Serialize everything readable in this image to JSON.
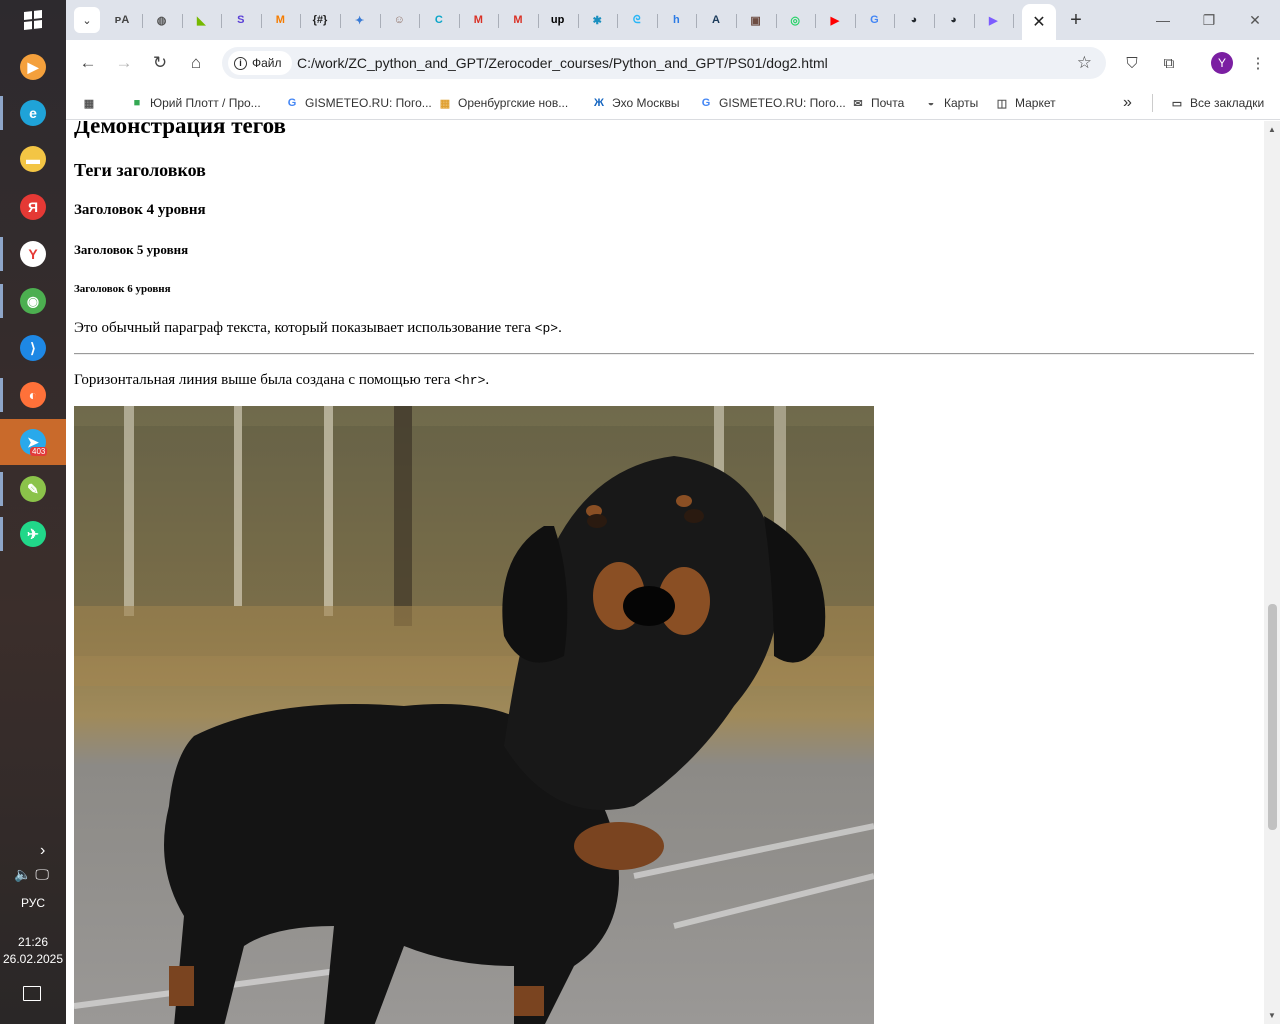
{
  "taskbar": {
    "apps": [
      {
        "name": "media-player-icon",
        "color": "#f4a03c",
        "glyph": "▶"
      },
      {
        "name": "edge-icon",
        "color": "#1fa3d8",
        "glyph": "e"
      },
      {
        "name": "file-explorer-icon",
        "color": "#f3c544",
        "glyph": "▬"
      },
      {
        "name": "yandex-icon",
        "color": "#e53935",
        "glyph": "Я"
      },
      {
        "name": "yandex-browser-icon",
        "color": "#ffffff",
        "glyph": "Y"
      },
      {
        "name": "chrome-icon",
        "color": "#4caf50",
        "glyph": "◉"
      },
      {
        "name": "vscode-icon",
        "color": "#1e88e5",
        "glyph": "⟩"
      },
      {
        "name": "firefox-icon",
        "color": "#ff7139",
        "glyph": "◐"
      },
      {
        "name": "telegram-icon",
        "color": "#29a9eb",
        "glyph": "➤"
      },
      {
        "name": "notepad-plus-icon",
        "color": "#8bc34a",
        "glyph": "✎"
      },
      {
        "name": "pycharm-icon",
        "color": "#21d789",
        "glyph": "✈"
      }
    ],
    "telegram_badge": "403",
    "language": "РУС",
    "time": "21:26",
    "date": "26.02.2025"
  },
  "browser": {
    "pinned_tabs": [
      {
        "name": "tab-translate",
        "glyph": "ᴘA",
        "color": "#444444"
      },
      {
        "name": "tab-globe",
        "glyph": "◍",
        "color": "#555555"
      },
      {
        "name": "tab-nvidia",
        "glyph": "◣",
        "color": "#76b900"
      },
      {
        "name": "tab-s",
        "glyph": "S",
        "color": "#5a3fd6"
      },
      {
        "name": "tab-m-orange",
        "glyph": "M",
        "color": "#f57c00"
      },
      {
        "name": "tab-hashtag",
        "glyph": "{#}",
        "color": "#222222"
      },
      {
        "name": "tab-bird",
        "glyph": "✦",
        "color": "#3a7bd5"
      },
      {
        "name": "tab-person",
        "glyph": "☺",
        "color": "#8d6e63"
      },
      {
        "name": "tab-copilot",
        "glyph": "C",
        "color": "#0aa5c8"
      },
      {
        "name": "tab-gmail",
        "glyph": "M",
        "color": "#d93025"
      },
      {
        "name": "tab-gmail-2",
        "glyph": "M",
        "color": "#d93025"
      },
      {
        "name": "tab-up",
        "glyph": "up",
        "color": "#000000"
      },
      {
        "name": "tab-openai",
        "glyph": "✱",
        "color": "#1a8fbf"
      },
      {
        "name": "tab-wave",
        "glyph": "ᘓ",
        "color": "#29b6f6"
      },
      {
        "name": "tab-h",
        "glyph": "h",
        "color": "#2c7be5"
      },
      {
        "name": "tab-a",
        "glyph": "A",
        "color": "#1a3a5a"
      },
      {
        "name": "tab-portrait",
        "glyph": "▣",
        "color": "#6d4c41"
      },
      {
        "name": "tab-whatsapp",
        "glyph": "◎",
        "color": "#25d366"
      },
      {
        "name": "tab-youtube",
        "glyph": "▶",
        "color": "#ff0000"
      },
      {
        "name": "tab-google",
        "glyph": "G",
        "color": "#4285f4"
      },
      {
        "name": "tab-github",
        "glyph": "◕",
        "color": "#24292f"
      },
      {
        "name": "tab-github-2",
        "glyph": "◕",
        "color": "#24292f"
      },
      {
        "name": "tab-gemini",
        "glyph": "▶",
        "color": "#7c5cff"
      }
    ],
    "active_tab_close": "✕",
    "new_tab": "+",
    "window_controls": {
      "minimize": "—",
      "restore": "❐",
      "close": "✕"
    },
    "address": {
      "chip_label": "Файл",
      "url": "C:/work/ZC_python_and_GPT/Zerocoder_courses/Python_and_GPT/PS01/dog2.html"
    },
    "profile_initial": "Y",
    "bookmarks": [
      {
        "label": "Юрий Плотт / Про...",
        "icon": "green-square-icon",
        "glyph": "■",
        "color": "#34a853"
      },
      {
        "label": "GISMETEO.RU: Пого...",
        "icon": "google-icon",
        "glyph": "G",
        "color": "#4285f4"
      },
      {
        "label": "Оренбургские нов...",
        "icon": "grid-icon",
        "glyph": "▦",
        "color": "#e0a030"
      },
      {
        "label": "Эхо Москвы",
        "icon": "echo-icon",
        "glyph": "Ж",
        "color": "#1565c0"
      },
      {
        "label": "GISMETEO.RU: Пого...",
        "icon": "google-icon",
        "glyph": "G",
        "color": "#4285f4"
      },
      {
        "label": "Почта",
        "icon": "mail-icon",
        "glyph": "✉",
        "color": "#555555"
      },
      {
        "label": "Карты",
        "icon": "maps-icon",
        "glyph": "◒",
        "color": "#555555"
      },
      {
        "label": "Маркет",
        "icon": "market-icon",
        "glyph": "◫",
        "color": "#555555"
      }
    ],
    "bookmarks_overflow": "»",
    "all_bookmarks_label": "Все закладки"
  },
  "page": {
    "h2": "Демонстрация тегов",
    "h3": "Теги заголовков",
    "h4": "Заголовок 4 уровня",
    "h5": "Заголовок 5 уровня",
    "h6": "Заголовок 6 уровня",
    "paragraph_text": "Это обычный параграф текста, который показывает использование тега ",
    "paragraph_code": "<p>",
    "paragraph_end": ".",
    "hr_text": "Горизонтальная линия выше была создана с помощью тега ",
    "hr_code": "<hr>",
    "hr_end": "."
  }
}
